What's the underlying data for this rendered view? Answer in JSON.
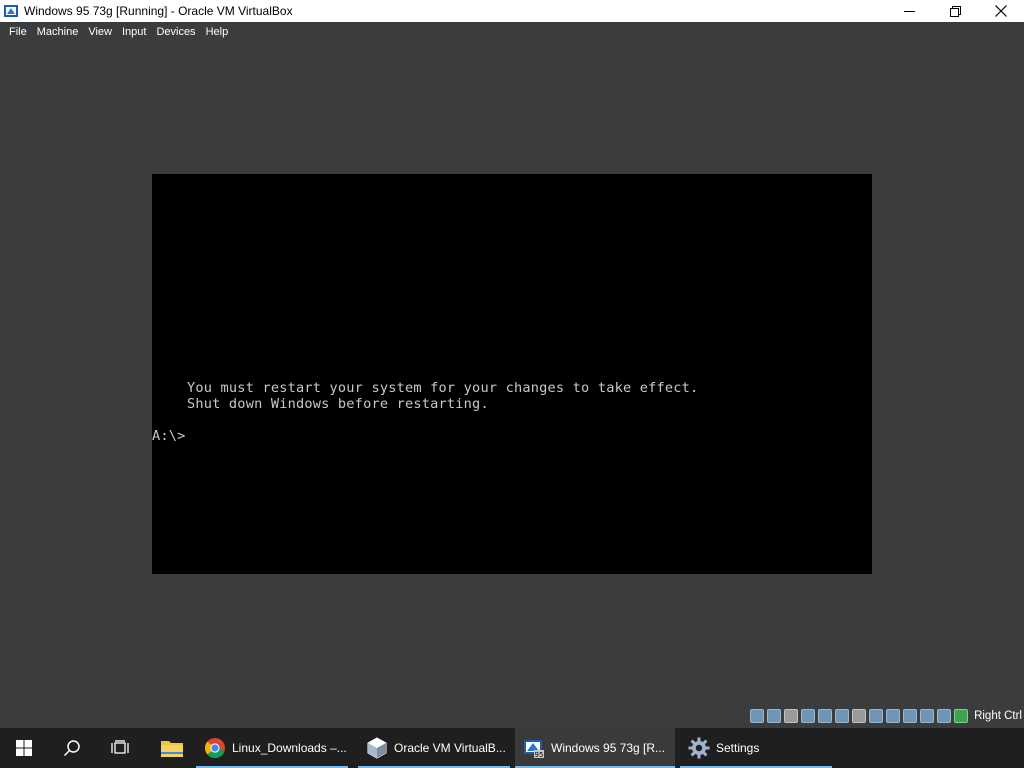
{
  "window": {
    "title": "Windows 95 73g [Running] - Oracle VM VirtualBox",
    "controls": {
      "minimize": "—",
      "restore": "❐",
      "close": "✕"
    }
  },
  "menubar": {
    "items": [
      {
        "label": "File"
      },
      {
        "label": "Machine"
      },
      {
        "label": "View"
      },
      {
        "label": "Input"
      },
      {
        "label": "Devices"
      },
      {
        "label": "Help"
      }
    ]
  },
  "console": {
    "line1": "You must restart your system for your changes to take effect.",
    "line2": "Shut down Windows before restarting.",
    "prompt": "A:\\>"
  },
  "statusbar": {
    "host_key": "Right Ctrl",
    "icons": [
      "hard-disk-icon",
      "optical-drive-icon",
      "floppy-icon",
      "audio-icon",
      "network-icon",
      "usb-icon",
      "shared-folders-icon",
      "display-icon",
      "recording-icon",
      "guest-additions-icon",
      "cpu-icon",
      "mouse-integration-icon",
      "keyboard-icon"
    ]
  },
  "taskbar": {
    "apps": [
      {
        "label": "Linux_Downloads –...",
        "icon": "chrome-icon"
      },
      {
        "label": "Oracle VM VirtualB...",
        "icon": "virtualbox-icon"
      },
      {
        "label": "Windows 95 73g [R...",
        "icon": "vm-window-icon"
      },
      {
        "label": "Settings",
        "icon": "gear-icon"
      }
    ]
  }
}
